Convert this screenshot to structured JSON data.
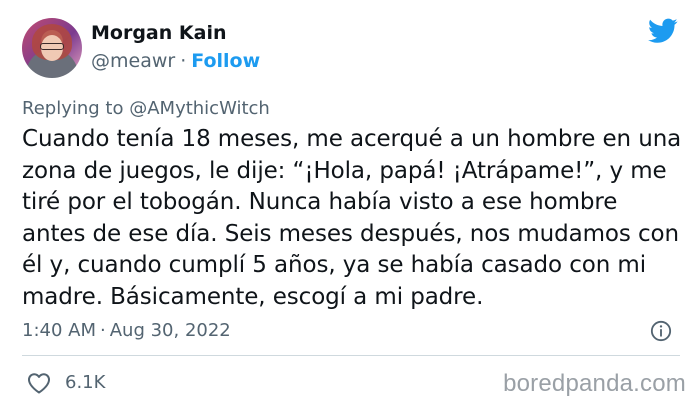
{
  "author": {
    "name": "Morgan Kain",
    "handle": "@meawr",
    "separator": "·",
    "follow_label": "Follow"
  },
  "reply": {
    "prefix": "Replying to",
    "mention": "@AMythicWitch"
  },
  "tweet": {
    "line1": "Cuando tenía 18 meses, me acerqué a un hombre en una",
    "line2": "zona de juegos, le dije: “¡Hola, papá! ¡Atrápame!”, y me",
    "line3": "tiré por el tobogán. Nunca había visto a ese hombre",
    "line4": "antes de ese día. Seis meses después, nos mudamos con",
    "line5": "él y, cuando cumplí 5 años, ya se había casado con mi",
    "line6": "madre. Básicamente, escogí a mi padre."
  },
  "meta": {
    "time": "1:40 AM",
    "separator": "·",
    "date": "Aug 30, 2022"
  },
  "stats": {
    "likes": "6.1K"
  },
  "watermark": "boredpanda.com",
  "icons": {
    "bird": "twitter-bird-icon",
    "info": "info-icon",
    "heart": "heart-icon"
  },
  "colors": {
    "accent": "#1d9bf0",
    "secondary_text": "#536471",
    "primary_text": "#0f1419"
  }
}
